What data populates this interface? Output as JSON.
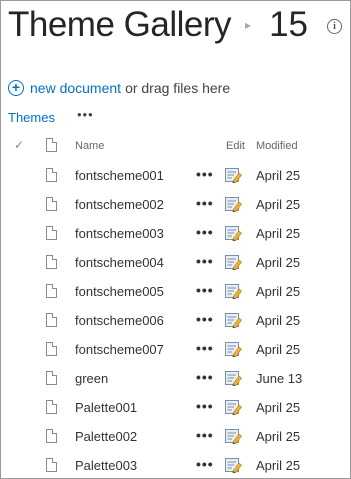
{
  "header": {
    "title": "Theme Gallery",
    "separator": "▸",
    "count": "15",
    "info_glyph": "i"
  },
  "toolbar": {
    "plus_glyph": "+",
    "new_document_label": "new document",
    "drag_text": "or drag files here"
  },
  "views": {
    "current": "Themes",
    "more_label": "•••"
  },
  "columns": {
    "check_glyph": "✓",
    "name": "Name",
    "edit": "Edit",
    "modified": "Modified"
  },
  "row_actions": {
    "ellipsis": "•••"
  },
  "files": [
    {
      "name": "fontscheme001",
      "modified": "April 25"
    },
    {
      "name": "fontscheme002",
      "modified": "April 25"
    },
    {
      "name": "fontscheme003",
      "modified": "April 25"
    },
    {
      "name": "fontscheme004",
      "modified": "April 25"
    },
    {
      "name": "fontscheme005",
      "modified": "April 25"
    },
    {
      "name": "fontscheme006",
      "modified": "April 25"
    },
    {
      "name": "fontscheme007",
      "modified": "April 25"
    },
    {
      "name": "green",
      "modified": "June 13"
    },
    {
      "name": "Palette001",
      "modified": "April 25"
    },
    {
      "name": "Palette002",
      "modified": "April 25"
    },
    {
      "name": "Palette003",
      "modified": "April 25"
    }
  ],
  "icons": {
    "info": "info-icon",
    "add": "plus-circle-icon",
    "document": "document-icon",
    "edit": "edit-pencil-icon",
    "check": "checkmark-icon"
  },
  "colors": {
    "link": "#0072c6",
    "title": "#262626"
  }
}
